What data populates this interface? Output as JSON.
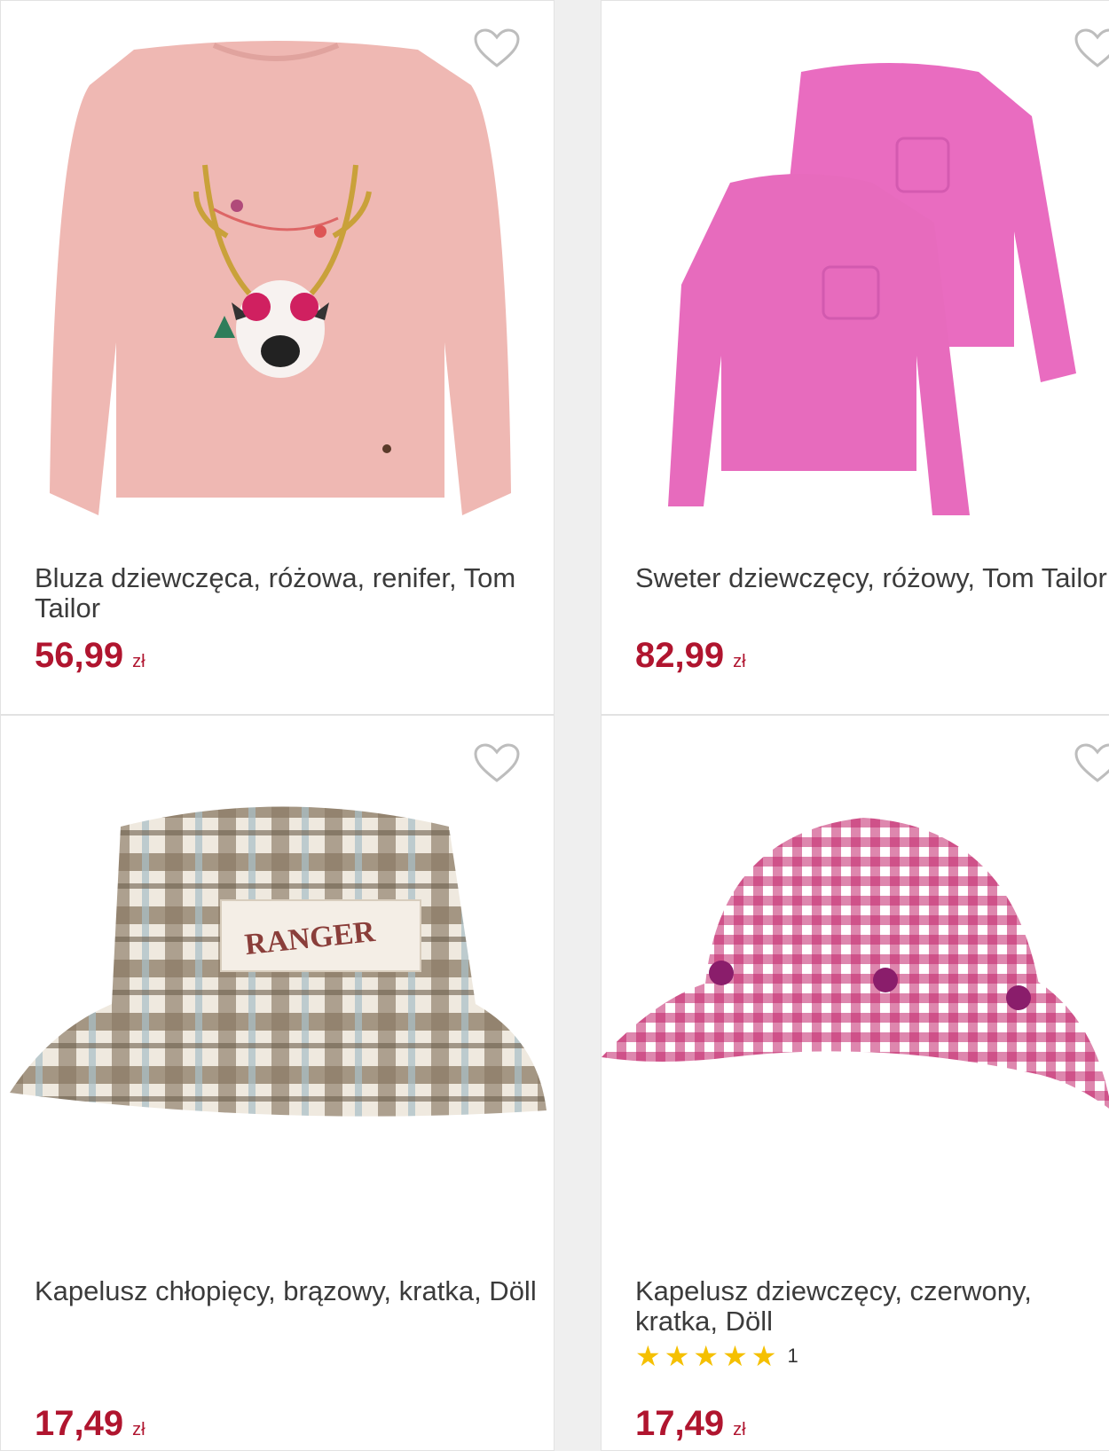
{
  "products": [
    {
      "title": "Bluza dziewczęca, różowa, renifer, Tom Tailor",
      "price": "56,99",
      "currency": "zł",
      "image_icon": "pink-reindeer-sweatshirt"
    },
    {
      "title": "Sweter dziewczęcy, różowy, Tom Tailor",
      "price": "82,99",
      "currency": "zł",
      "image_icon": "pink-sweater-pair"
    },
    {
      "title": "Kapelusz chłopięcy, brązowy, kratka, Döll",
      "price": "17,49",
      "currency": "zł",
      "image_icon": "brown-plaid-bucket-hat",
      "patch_text": "RANGER"
    },
    {
      "title": "Kapelusz dziewczęcy, czerwony, kratka, Döll",
      "price": "17,49",
      "currency": "zł",
      "image_icon": "red-gingham-hat",
      "rating": {
        "stars": 5,
        "count": "1"
      }
    }
  ],
  "colors": {
    "price": "#b0152f",
    "star": "#f5c000",
    "wishlist_icon": "#bdbdbd"
  },
  "wishlist_icon": "heart-outline-icon"
}
